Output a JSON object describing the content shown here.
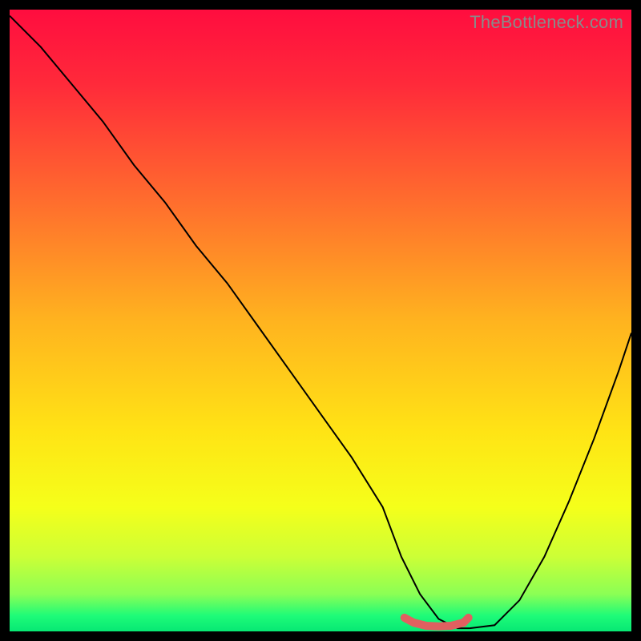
{
  "watermark": "TheBottleneck.com",
  "chart_data": {
    "type": "line",
    "title": "",
    "xlabel": "",
    "ylabel": "",
    "xlim": [
      0,
      100
    ],
    "ylim": [
      0,
      100
    ],
    "background_gradient": {
      "stops": [
        {
          "pos": 0.0,
          "color": "#ff0d3f"
        },
        {
          "pos": 0.12,
          "color": "#ff2a3a"
        },
        {
          "pos": 0.3,
          "color": "#ff6a2e"
        },
        {
          "pos": 0.5,
          "color": "#ffb31f"
        },
        {
          "pos": 0.68,
          "color": "#ffe415"
        },
        {
          "pos": 0.8,
          "color": "#f5ff1a"
        },
        {
          "pos": 0.88,
          "color": "#ccff36"
        },
        {
          "pos": 0.94,
          "color": "#8bff55"
        },
        {
          "pos": 0.975,
          "color": "#1efb78"
        },
        {
          "pos": 1.0,
          "color": "#07e874"
        }
      ]
    },
    "series": [
      {
        "name": "bottleneck-curve",
        "color": "#000000",
        "width": 2,
        "x": [
          0,
          5,
          10,
          15,
          20,
          25,
          30,
          35,
          40,
          45,
          50,
          55,
          60,
          63,
          66,
          69,
          72,
          74,
          78,
          82,
          86,
          90,
          94,
          98,
          100
        ],
        "values": [
          99,
          94,
          88,
          82,
          75,
          69,
          62,
          56,
          49,
          42,
          35,
          28,
          20,
          12,
          6,
          2,
          0.5,
          0.5,
          1,
          5,
          12,
          21,
          31,
          42,
          48
        ]
      },
      {
        "name": "optimal-marker",
        "color": "#e06060",
        "width": 10,
        "x": [
          63.5,
          65,
          67,
          69,
          71,
          73,
          73.8
        ],
        "values": [
          2.2,
          1.4,
          0.9,
          0.8,
          0.9,
          1.4,
          2.2
        ]
      }
    ]
  }
}
